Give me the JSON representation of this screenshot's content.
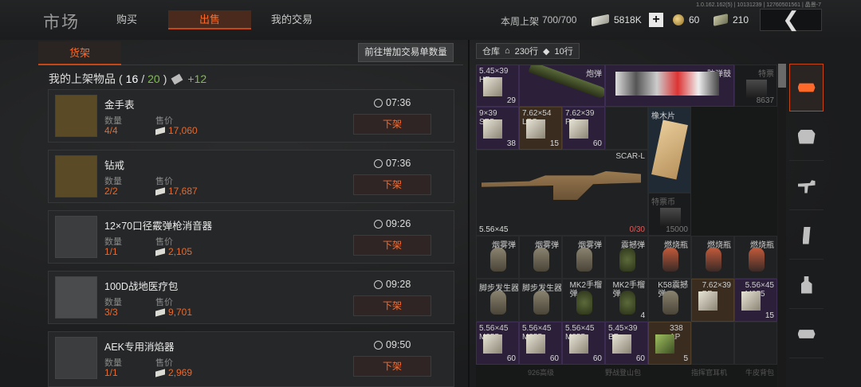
{
  "header": {
    "title": "市场",
    "tabs": [
      {
        "label": "购买",
        "active": false
      },
      {
        "label": "出售",
        "active": true
      },
      {
        "label": "我的交易",
        "active": false
      }
    ],
    "build_info": "1.0.162.162(5) | 10131239 | 127605015​61 | 晶景-7",
    "weekly_listing_label": "本周上架",
    "weekly_listing_value": "700/700",
    "cash": "5818K",
    "plus_label": "+",
    "coins": "60",
    "tickets": "210",
    "back_icon": "chevron-left-icon"
  },
  "left": {
    "shelf_tab": "货架",
    "add_slot_button": "前往增加交易单数量",
    "my_listings_label": "我的上架物品",
    "listing_used": "16",
    "listing_total": "20",
    "bonus": "+12",
    "qty_label": "数量",
    "price_label": "售价",
    "delist_label": "下架",
    "items": [
      {
        "name": "金手表",
        "qty": "4/4",
        "price": "17,060",
        "time": "07:36"
      },
      {
        "name": "钻戒",
        "qty": "2/2",
        "price": "17,687",
        "time": "07:36"
      },
      {
        "name": "12×70口径霰弹枪消音器",
        "qty": "1/1",
        "price": "2,105",
        "time": "09:26"
      },
      {
        "name": "100D战地医疗包",
        "qty": "3/3",
        "price": "9,701",
        "time": "09:28"
      },
      {
        "name": "AEK专用消焰器",
        "qty": "1/1",
        "price": "2,969",
        "time": "09:50"
      }
    ]
  },
  "right": {
    "warehouse_label": "仓库",
    "rows_label": "230行",
    "rows2_label": "10行",
    "cells": {
      "c1": {
        "name": "5.45×39\nHP",
        "count": "29"
      },
      "c2": {
        "name": "炮弹"
      },
      "c3": {
        "name": "防弹鼓"
      },
      "c4": {
        "name": "特票",
        "count": "8637"
      },
      "c5": {
        "name": "9×39\nSP5",
        "count": "38"
      },
      "c6": {
        "name": "7.62×54\nLPS",
        "count": "15"
      },
      "c7": {
        "name": "7.62×39\nPS",
        "count": "60"
      },
      "c8": {
        "name": "橡木片"
      },
      "c9": {
        "name": "SCAR-L",
        "caliber": "5.56×45",
        "count": "0/30"
      },
      "c10": {
        "name": "特票币",
        "count": "15000"
      },
      "s1": {
        "name": "烟雾弹"
      },
      "s2": {
        "name": "烟雾弹"
      },
      "s3": {
        "name": "烟雾弹"
      },
      "s4": {
        "name": "震撼弹"
      },
      "s5": {
        "name": "燃烧瓶"
      },
      "s6": {
        "name": "燃烧瓶"
      },
      "s7": {
        "name": "燃烧瓶"
      },
      "t1": {
        "name": "脚步发生器"
      },
      "t2": {
        "name": "脚步发生器"
      },
      "t3": {
        "name": "MK2手榴\n弹"
      },
      "t4": {
        "name": "MK2手榴\n弹",
        "count": "4"
      },
      "t5": {
        "name": "K58震撼\n弹"
      },
      "t6": {
        "name": "7.62×39\nBP"
      },
      "t7": {
        "name": "5.56×45\nM855",
        "count": "15"
      },
      "u1": {
        "name": "5.56×45\nM855",
        "count": "60"
      },
      "u2": {
        "name": "5.56×45\nM855",
        "count": "60"
      },
      "u3": {
        "name": "5.56×45\nM855",
        "count": "60"
      },
      "u4": {
        "name": "5.45×39\nBP",
        "count": "60"
      },
      "u5": {
        "name": "338\nAP",
        "count": "5"
      }
    },
    "bottom": [
      "926高级",
      "野战登山包",
      "指挥官耳机",
      "牛皮背包"
    ]
  },
  "sidebar": [
    {
      "icon": "stack-icon",
      "active": true
    },
    {
      "icon": "vest-icon",
      "active": false
    },
    {
      "icon": "rifle-icon",
      "active": false
    },
    {
      "icon": "magazine-icon",
      "active": false
    },
    {
      "icon": "bottle-icon",
      "active": false
    },
    {
      "icon": "helmet-icon",
      "active": false
    }
  ]
}
